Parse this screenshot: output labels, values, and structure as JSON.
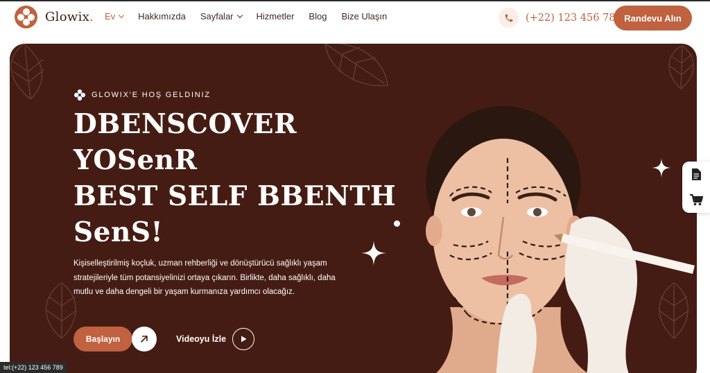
{
  "brand": {
    "name": "Glowix",
    "dot": ".",
    "accent": "#c0613f",
    "dark": "#451c13"
  },
  "nav": {
    "items": [
      {
        "label": "Ev",
        "dropdown": true,
        "active": true
      },
      {
        "label": "Hakkımızda",
        "dropdown": false
      },
      {
        "label": "Sayfalar",
        "dropdown": true
      },
      {
        "label": "Hizmetler",
        "dropdown": false
      },
      {
        "label": "Blog",
        "dropdown": false
      },
      {
        "label": "Bize Ulaşın",
        "dropdown": false
      }
    ]
  },
  "header": {
    "phone": "(+22) 123 456 789",
    "phone_icon": "phone-icon",
    "cta": "Randevu Alın"
  },
  "hero": {
    "eyebrow": "GLOWIX'E HOŞ GELDINIZ",
    "headline_lines": [
      "DBENSCOVER",
      "YOSenR",
      "BEST SELF BBENTH",
      "SenS!"
    ],
    "description": "Kişiselleştirilmiş koçluk, uzman rehberliği ve dönüştürücü sağlıklı yaşam stratejileriyle tüm potansiyelinizi ortaya çıkarın. Birlikte, daha sağlıklı, daha mutlu ve daha dengeli bir yaşam kurmanıza yardımcı olacağız.",
    "primary_button": "Başlayın",
    "video_button": "Videoyu İzle"
  },
  "sidebar": {
    "icons": [
      "document-icon",
      "cart-icon"
    ]
  },
  "status_bar": {
    "link": "tel:(+22) 123 456 789"
  }
}
